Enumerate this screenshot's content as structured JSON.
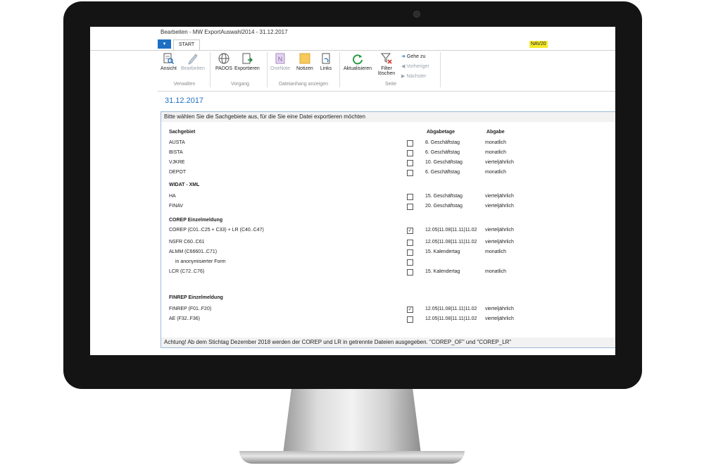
{
  "window": {
    "title": "Bearbeiten - MW ExportAuswahl2014 - 31.12.2017"
  },
  "ribbon_tabs": {
    "menu_label": "▾",
    "start_label": "START",
    "badge": "NAV20"
  },
  "ribbon": {
    "buttons": {
      "ansicht": "Ansicht",
      "bearbeiten": "Bearbeiten",
      "pados": "PADOS",
      "exportieren": "Exportieren",
      "onenote": "OneNote",
      "notizen": "Notizen",
      "links": "Links",
      "aktualisieren": "Aktualisieren",
      "filter_line1": "Filter",
      "filter_line2": "löschen"
    },
    "nav": {
      "gehe_zu": "Gehe zu",
      "vorheriger": "Vorheriger",
      "naechster": "Nächster"
    },
    "groups": {
      "verwalten": "Verwalten",
      "vorgang": "Vorgang",
      "dateianhang": "Dateianhang anzeigen",
      "seite": "Seite"
    }
  },
  "page": {
    "date": "31.12.2017"
  },
  "panel": {
    "instruction": "Bitte wählen Sie die Sachgebiete aus, für die Sie eine Datei exportieren möchten",
    "headers": {
      "sachgebiet": "Sachgebiet",
      "abgabetage": "Abgabetage",
      "abgabe": "Abgabe"
    },
    "rows": [
      {
        "name": "AUSTA",
        "checked": false,
        "days": "8. Geschäftstag",
        "freq": "monatlich"
      },
      {
        "name": "BISTA",
        "checked": false,
        "days": "6. Geschäftstag",
        "freq": "monatlich"
      },
      {
        "name": "VJKRE",
        "checked": false,
        "days": "10. Geschäftstag",
        "freq": "vierteljährlich"
      },
      {
        "name": "DEPOT",
        "checked": false,
        "days": "6. Geschäftstag",
        "freq": "monatlich"
      },
      {
        "name": "HA",
        "checked": false,
        "days": "15. Geschäftstag",
        "freq": "vierteljährlich"
      },
      {
        "name": "FINAV",
        "checked": false,
        "days": "20. Geschäftstag",
        "freq": "vierteljährlich"
      },
      {
        "name": "COREP (C01..C25 + C33) + LR (C40..C47)",
        "checked": true,
        "days": "12.05|11.08|11.11|11.02",
        "freq": "vierteljährlich"
      },
      {
        "name": "NSFR C60..C61",
        "checked": false,
        "days": "12.05|11.08|11.11|11.02",
        "freq": "vierteljährlich"
      },
      {
        "name": "ALMM (C66601..C71)",
        "checked": false,
        "days": "15. Kalendertag",
        "freq": "monatlich"
      },
      {
        "name": "in anonymisierter Form",
        "checked": false,
        "days": "",
        "freq": ""
      },
      {
        "name": "LCR (C72..C76)",
        "checked": false,
        "days": "15. Kalendertag",
        "freq": "monatlich"
      },
      {
        "name": "FINREP (F01..F20)",
        "checked": true,
        "days": "12.05|11.08|11.11|11.02",
        "freq": "vierteljährlich"
      },
      {
        "name": "AE (F32..F36)",
        "checked": false,
        "days": "12.05|11.08|11.11|11.02",
        "freq": "vierteljährlich"
      }
    ],
    "sections": {
      "widat": "WIDAT - XML",
      "corep": "COREP Einzelmeldung",
      "finrep": "FINREP Einzelmeldung"
    },
    "footer": "Achtung! Ab dem Stichtag Dezember 2018 werden der COREP und LR in getrennte Dateien ausgegeben. \"COREP_OF\" und \"COREP_LR\""
  },
  "icons": {
    "ansicht": "view-icon",
    "bearbeiten": "edit-pencil-icon",
    "pados": "globe-icon",
    "exportieren": "export-document-icon",
    "onenote": "onenote-icon",
    "notizen": "sticky-note-icon",
    "links": "link-document-icon",
    "aktualisieren": "refresh-icon",
    "filter": "clear-filter-icon"
  },
  "colors": {
    "accent": "#1e6fc2",
    "badge": "#f5ea2c",
    "bezel": "#141414"
  }
}
